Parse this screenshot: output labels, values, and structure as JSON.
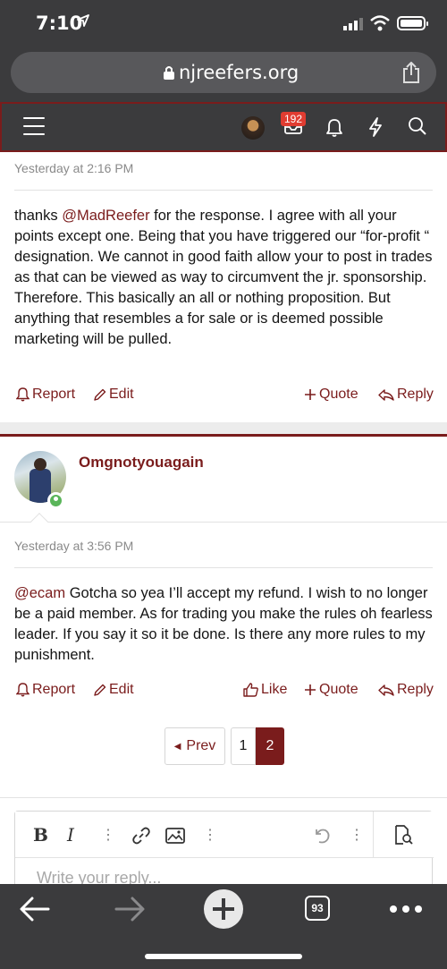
{
  "status_bar": {
    "time": "7:10"
  },
  "browser": {
    "url": "njreefers.org",
    "tab_count": "93"
  },
  "site_nav": {
    "alerts_badge": "192"
  },
  "post1": {
    "timestamp": "Yesterday at 2:16 PM",
    "text_before_mention": "thanks ",
    "mention": "@MadReefer",
    "text_after_mention": " for the response. I agree with all your points except one. Being that you have triggered our “for-profit “ designation. We cannot in good faith allow your to post in trades as that can be viewed as way to circumvent the jr. sponsorship.",
    "text_para2": "Therefore. This basically an all or nothing proposition. But anything that resembles a for sale or is deemed possible marketing will be pulled.",
    "actions": {
      "report": "Report",
      "edit": "Edit",
      "quote": "Quote",
      "reply": "Reply"
    }
  },
  "post2": {
    "author": "Omgnotyouagain",
    "timestamp": "Yesterday at 3:56 PM",
    "mention": "@ecam",
    "text_after_mention": " Gotcha so yea I’ll accept my refund. I wish to no longer be a paid member. As for trading you make the rules oh fearless leader. If you say it so it be done. Is there any more rules to my punishment.",
    "actions": {
      "report": "Report",
      "edit": "Edit",
      "like": "Like",
      "quote": "Quote",
      "reply": "Reply"
    }
  },
  "pagination": {
    "prev": "Prev",
    "pages": [
      "1",
      "2"
    ],
    "current": "2"
  },
  "editor": {
    "placeholder": "Write your reply..."
  },
  "colors": {
    "accent": "#7a1c1c",
    "chrome": "#3b3b3d",
    "badge": "#e03c31",
    "online": "#5ab55a"
  }
}
